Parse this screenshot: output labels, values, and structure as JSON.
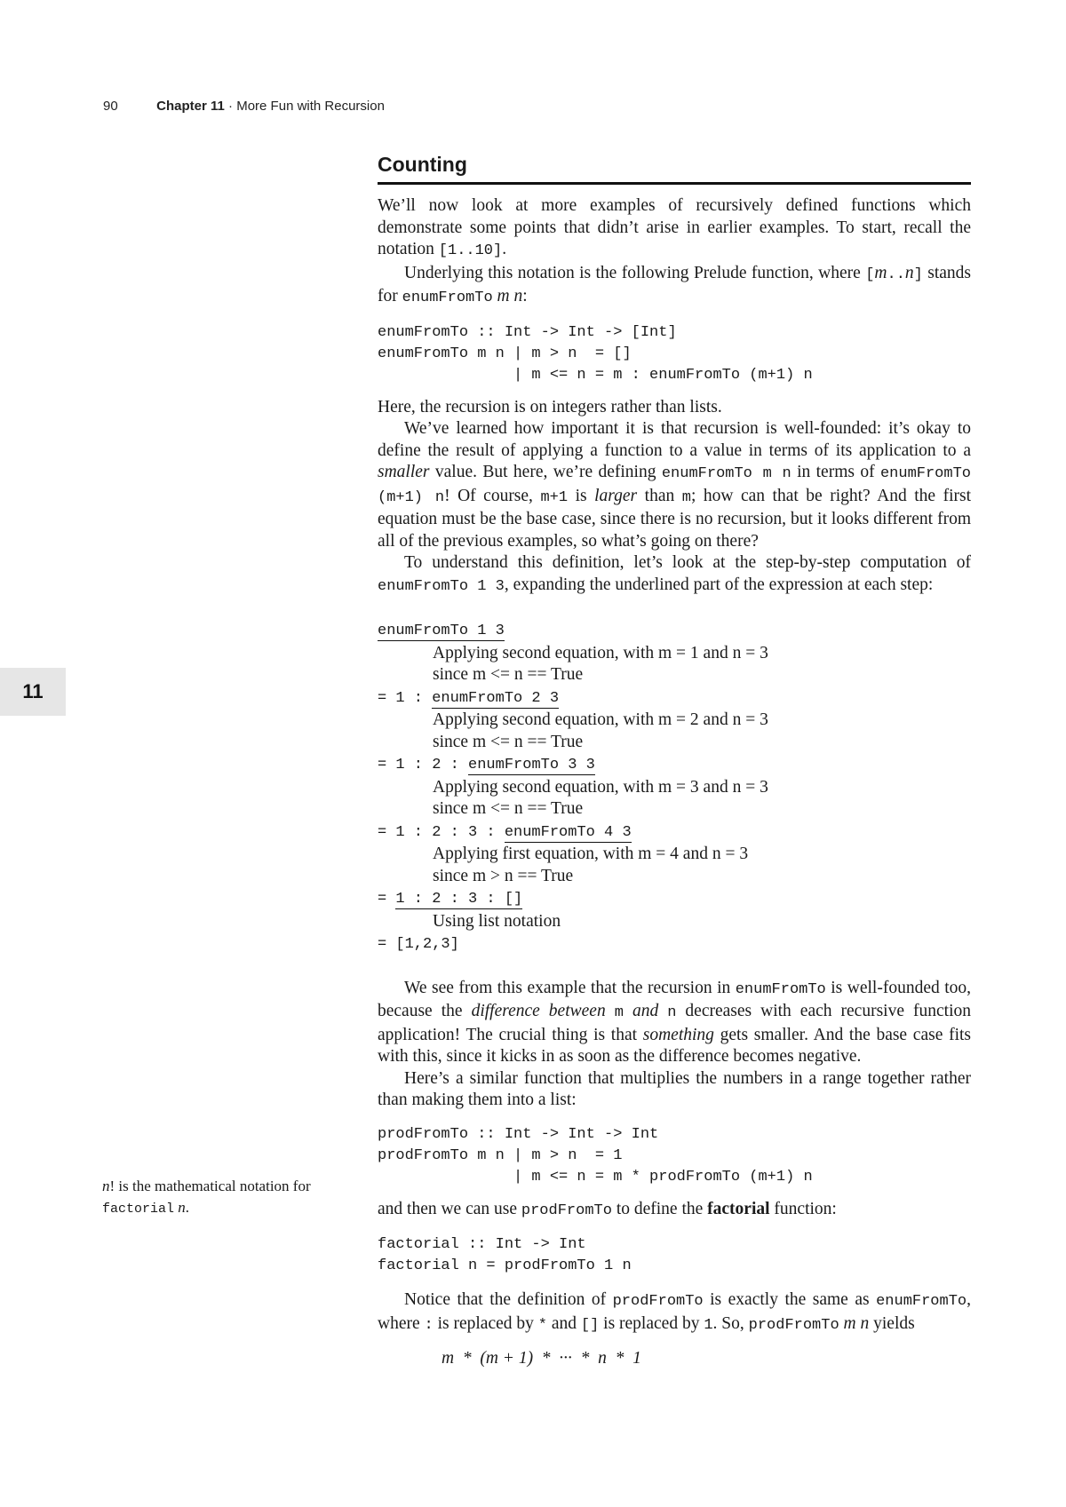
{
  "header": {
    "page_number": "90",
    "chapter_label": "Chapter 11",
    "separator": " · ",
    "chapter_title": "More Fun with Recursion"
  },
  "chapter_tab": "11",
  "section": {
    "title": "Counting"
  },
  "paragraphs": {
    "p1": {
      "a": "We’ll now look at more examples of recursively defined functions which demonstrate some points that didn’t arise in earlier examples. To start, recall the notation ",
      "code": "[1..10]",
      "b": "."
    },
    "p2": {
      "a": "Underlying this notation is the following Prelude function, where ",
      "code1": "[",
      "m": "m",
      "dots": "..",
      "n": "n",
      "code2": "]",
      "b": " stands for ",
      "code3": "enumFromTo",
      "mn": " m n",
      "c": ":"
    },
    "code1": "enumFromTo :: Int -> Int -> [Int]\nenumFromTo m n | m > n  = []\n               | m <= n = m : enumFromTo (m+1) n",
    "p3": "Here, the recursion is on integers rather than lists.",
    "p4": {
      "a": "We’ve learned how important it is that recursion is well-founded: it’s okay to define the result of applying a function to a value in terms of its application to a ",
      "smaller": "smaller",
      "b": " value. But here, we’re defining ",
      "code1": "enumFromTo m n",
      "c": " in terms of ",
      "code2": "enumFromTo (m+1) n",
      "d": "! Of course, ",
      "code3": "m+1",
      "e": " is ",
      "larger": "larger",
      "f": " than ",
      "code4": "m",
      "g": "; how can that be right? And the first equation must be the base case, since there is no recursion, but it looks different from all of the previous examples, so what’s going on there?"
    },
    "p5": {
      "a": "To understand this definition, let’s look at the step-by-step computation of ",
      "code": "enumFromTo 1 3",
      "b": ", expanding the underlined part of the expression at each step:"
    }
  },
  "trace": [
    {
      "prefix": "",
      "underlined": "enumFromTo 1 3",
      "note": "Applying second equation, with m = 1 and n = 3",
      "since": "since m <= n == True"
    },
    {
      "prefix": "= 1 : ",
      "underlined": "enumFromTo 2 3",
      "note": "Applying second equation, with m = 2 and n = 3",
      "since": "since m <= n == True"
    },
    {
      "prefix": "= 1 : 2 : ",
      "underlined": "enumFromTo 3 3",
      "note": "Applying second equation, with m = 3 and n = 3",
      "since": "since m <= n == True"
    },
    {
      "prefix": "= 1 : 2 : 3 : ",
      "underlined": "enumFromTo 4 3",
      "note": "Applying first equation, with m = 4 and n = 3",
      "since": "since m > n == True"
    },
    {
      "prefix": "= ",
      "underlined": "1 : 2 : 3 : []",
      "note": "Using list notation",
      "since": ""
    },
    {
      "prefix": "= [1,2,3]",
      "underlined": "",
      "note": "",
      "since": ""
    }
  ],
  "paragraphs2": {
    "p6": {
      "a": "We see from this example that the recursion in ",
      "code1": "enumFromTo",
      "b": " is well-founded too, because the ",
      "it1": "difference between",
      "code2": "m",
      "it2": "and",
      "code3": "n",
      "c": " decreases with each recursive function application! The crucial thing is that ",
      "it3": "something",
      "d": " gets smaller. And the base case fits with this, since it kicks in as soon as the difference becomes negative."
    },
    "p7": "Here’s a similar function that multiplies the numbers in a range together rather than making them into a list:",
    "code2": "prodFromTo :: Int -> Int -> Int\nprodFromTo m n | m > n  = 1\n               | m <= n = m * prodFromTo (m+1) n",
    "p8": {
      "a": "and then we can use ",
      "code": "prodFromTo",
      "b": " to define the ",
      "bold": "factorial",
      "c": " function:"
    },
    "code3": "factorial :: Int -> Int\nfactorial n = prodFromTo 1 n",
    "p9": {
      "a": "Notice that the definition of ",
      "code1": "prodFromTo",
      "b": " is exactly the same as ",
      "code2": "enumFromTo",
      "c": ", where ",
      "code3": ":",
      "d": " is replaced by ",
      "code4": "*",
      "e": " and ",
      "code5": "[]",
      "f": " is replaced by ",
      "code6": "1",
      "g": ". So, ",
      "code7": "prodFromTo",
      "mn": " m n",
      "h": " yields"
    },
    "math": "m  *  (m + 1)  *  ···  *  n  *  1"
  },
  "side_note": {
    "a": "n",
    "b": "! is the mathematical notation for ",
    "code": "factorial",
    "c": " n",
    "d": "."
  }
}
